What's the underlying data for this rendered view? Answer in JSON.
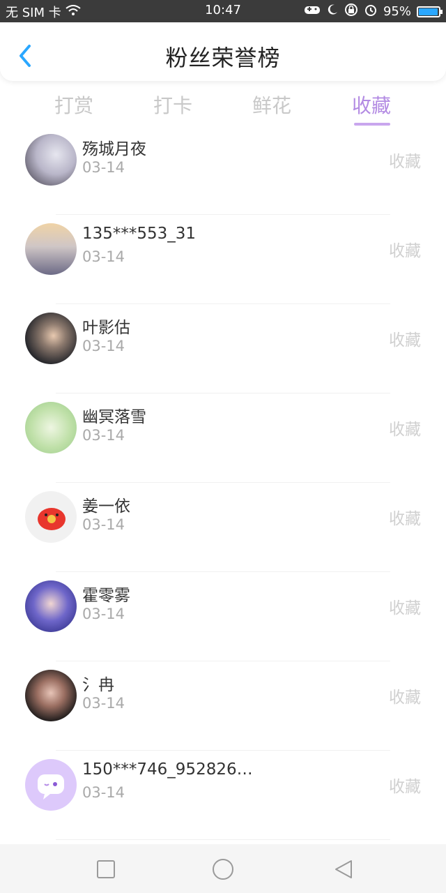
{
  "status": {
    "carrier": "无 SIM 卡",
    "time": "10:47",
    "battery": "95%",
    "battery_level": 0.95
  },
  "header": {
    "title": "粉丝荣誉榜",
    "back_icon": "chevron-left-icon",
    "accent": "#2aa7ff"
  },
  "tabs": [
    {
      "label": "打赏"
    },
    {
      "label": "打卡"
    },
    {
      "label": "鲜花"
    },
    {
      "label": "收藏",
      "active": true
    }
  ],
  "tab_active_color": "#b38be3",
  "entries": [
    {
      "name": "殇城月夜",
      "date": "03-14",
      "action": "收藏"
    },
    {
      "name": "135***553_31",
      "date": "03-14",
      "action": "收藏"
    },
    {
      "name": "叶影估",
      "date": "03-14",
      "action": "收藏"
    },
    {
      "name": "幽冥落雪",
      "date": "03-14",
      "action": "收藏"
    },
    {
      "name": "姜一依",
      "date": "03-14",
      "action": "收藏"
    },
    {
      "name": "霍零雾",
      "date": "03-14",
      "action": "收藏"
    },
    {
      "name": "氵冉",
      "date": "03-14",
      "action": "收藏"
    },
    {
      "name": "150***746_952826…",
      "date": "03-14",
      "action": "收藏"
    }
  ],
  "navbar": {
    "icons": [
      "square-icon",
      "circle-icon",
      "triangle-back-icon"
    ]
  }
}
